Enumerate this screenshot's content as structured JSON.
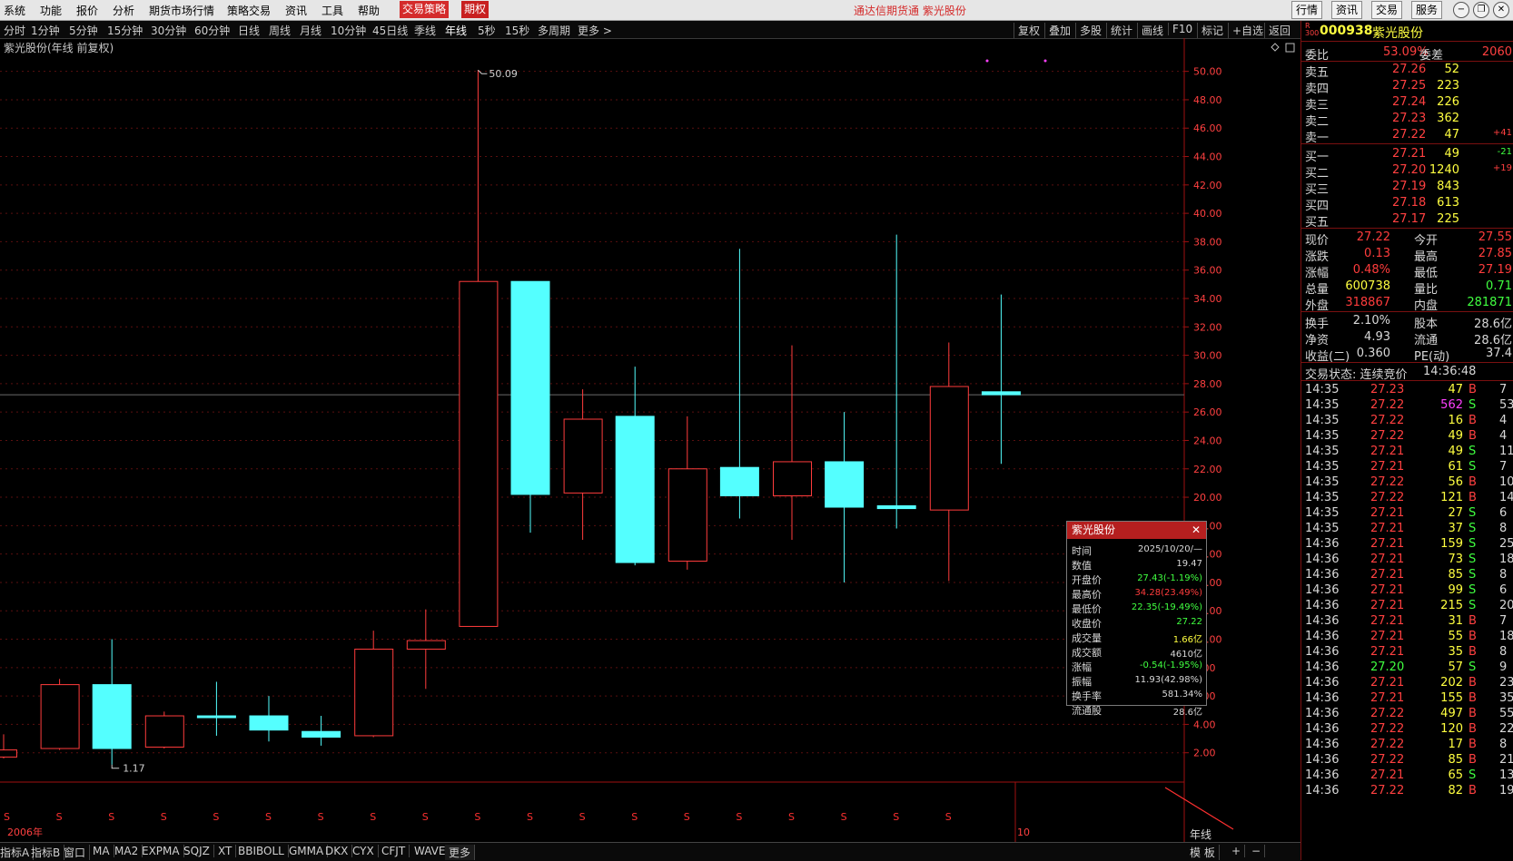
{
  "menu": {
    "items": [
      "系统",
      "功能",
      "报价",
      "分析",
      "期货市场行情",
      "策略交易",
      "资讯",
      "工具",
      "帮助",
      "交易策略",
      "期权"
    ],
    "title": "通达信期货通  紫光股份",
    "buttons": [
      "行情",
      "资讯",
      "交易",
      "服务"
    ]
  },
  "periods": {
    "items": [
      "分时",
      "1分钟",
      "5分钟",
      "15分钟",
      "30分钟",
      "60分钟",
      "日线",
      "周线",
      "月线",
      "10分钟",
      "45日线",
      "季线",
      "年线",
      "5秒",
      "15秒",
      "多周期",
      "更多 >"
    ],
    "active": "年线",
    "right_tools": [
      "复权",
      "叠加",
      "多股",
      "统计",
      "画线",
      "F10",
      "标记",
      "+自选",
      "返回"
    ]
  },
  "chart": {
    "label": "紫光股份(年线 前复权)",
    "max_label": "50.09",
    "min_label": "1.17",
    "start_year": "2006年",
    "end_marker": "10",
    "period_tag": "年线",
    "dividend_marker": "S",
    "colors": {
      "up": "#ff3c3c",
      "down": "#54ffff",
      "axis": "#a01010",
      "grid": "#5a0f0f"
    }
  },
  "chart_data": {
    "type": "candlestick",
    "title": "紫光股份(年线 前复权)",
    "ylim": [
      0,
      51
    ],
    "yticks": [
      2,
      4,
      6,
      8,
      10,
      12,
      14,
      16,
      18,
      20,
      22,
      24,
      26,
      28,
      30,
      32,
      34,
      36,
      38,
      40,
      42,
      44,
      46,
      48,
      50
    ],
    "candles": [
      {
        "open": 1.7,
        "close": 2.2,
        "high": 3.3,
        "low": 1.6,
        "dir": "up"
      },
      {
        "open": 2.3,
        "close": 6.8,
        "high": 7.2,
        "low": 2.2,
        "dir": "up"
      },
      {
        "open": 6.8,
        "close": 2.3,
        "high": 10.0,
        "low": 1.17,
        "dir": "down"
      },
      {
        "open": 2.4,
        "close": 4.6,
        "high": 4.9,
        "low": 2.3,
        "dir": "up"
      },
      {
        "open": 4.6,
        "close": 4.5,
        "high": 7.0,
        "low": 3.2,
        "dir": "down"
      },
      {
        "open": 4.6,
        "close": 3.6,
        "high": 6.0,
        "low": 2.8,
        "dir": "down"
      },
      {
        "open": 3.5,
        "close": 3.1,
        "high": 4.6,
        "low": 2.5,
        "dir": "down"
      },
      {
        "open": 3.2,
        "close": 9.3,
        "high": 10.6,
        "low": 3.1,
        "dir": "up"
      },
      {
        "open": 9.3,
        "close": 9.9,
        "high": 12.1,
        "low": 6.5,
        "dir": "up"
      },
      {
        "open": 10.9,
        "close": 35.2,
        "high": 50.09,
        "low": 10.9,
        "dir": "up"
      },
      {
        "open": 35.2,
        "close": 20.2,
        "high": 35.2,
        "low": 17.5,
        "dir": "down"
      },
      {
        "open": 20.3,
        "close": 25.5,
        "high": 27.6,
        "low": 17.0,
        "dir": "up"
      },
      {
        "open": 25.7,
        "close": 15.4,
        "high": 29.2,
        "low": 15.2,
        "dir": "down"
      },
      {
        "open": 15.5,
        "close": 22.0,
        "high": 25.7,
        "low": 14.9,
        "dir": "up"
      },
      {
        "open": 22.1,
        "close": 20.1,
        "high": 37.5,
        "low": 18.5,
        "dir": "down"
      },
      {
        "open": 20.1,
        "close": 22.5,
        "high": 30.7,
        "low": 17.0,
        "dir": "up"
      },
      {
        "open": 22.5,
        "close": 19.3,
        "high": 26.0,
        "low": 14.0,
        "dir": "down"
      },
      {
        "open": 19.4,
        "close": 19.2,
        "high": 38.5,
        "low": 17.8,
        "dir": "down"
      },
      {
        "open": 19.1,
        "close": 27.8,
        "high": 30.9,
        "low": 14.1,
        "dir": "up"
      },
      {
        "open": 27.43,
        "close": 27.22,
        "high": 34.28,
        "low": 22.35,
        "dir": "down"
      }
    ]
  },
  "quote": {
    "code": "000938",
    "name": "紫光股份",
    "badge": "R\n300",
    "weibi_label": "委比",
    "weibi": "53.09%",
    "weicha_label": "委差",
    "weicha": "2060",
    "asks": [
      {
        "label": "卖五",
        "price": "27.26",
        "vol": "52",
        "chg": ""
      },
      {
        "label": "卖四",
        "price": "27.25",
        "vol": "223",
        "chg": ""
      },
      {
        "label": "卖三",
        "price": "27.24",
        "vol": "226",
        "chg": ""
      },
      {
        "label": "卖二",
        "price": "27.23",
        "vol": "362",
        "chg": ""
      },
      {
        "label": "卖一",
        "price": "27.22",
        "vol": "47",
        "chg": "+41"
      }
    ],
    "bids": [
      {
        "label": "买一",
        "price": "27.21",
        "vol": "49",
        "chg": "-21"
      },
      {
        "label": "买二",
        "price": "27.20",
        "vol": "1240",
        "chg": "+19"
      },
      {
        "label": "买三",
        "price": "27.19",
        "vol": "843",
        "chg": ""
      },
      {
        "label": "买四",
        "price": "27.18",
        "vol": "613",
        "chg": ""
      },
      {
        "label": "买五",
        "price": "27.17",
        "vol": "225",
        "chg": ""
      }
    ],
    "stats": [
      {
        "l1": "现价",
        "v1": "27.22",
        "c1": "#ff3c3c",
        "l2": "今开",
        "v2": "27.55",
        "c2": "#ff3c3c"
      },
      {
        "l1": "涨跌",
        "v1": "0.13",
        "c1": "#ff3c3c",
        "l2": "最高",
        "v2": "27.85",
        "c2": "#ff3c3c"
      },
      {
        "l1": "涨幅",
        "v1": "0.48%",
        "c1": "#ff3c3c",
        "l2": "最低",
        "v2": "27.19",
        "c2": "#ff3c3c"
      },
      {
        "l1": "总量",
        "v1": "600738",
        "c1": "#ffff40",
        "l2": "量比",
        "v2": "0.71",
        "c2": "#40ff40"
      },
      {
        "l1": "外盘",
        "v1": "318867",
        "c1": "#ff3c3c",
        "l2": "内盘",
        "v2": "281871",
        "c2": "#40ff40"
      }
    ],
    "stats2": [
      {
        "l1": "换手",
        "v1": "2.10%",
        "l2": "股本",
        "v2": "28.6亿"
      },
      {
        "l1": "净资",
        "v1": "4.93",
        "l2": "流通",
        "v2": "28.6亿"
      },
      {
        "l1": "收益(二)",
        "v1": "0.360",
        "l2": "PE(动)",
        "v2": "37.4"
      }
    ],
    "status_label": "交易状态: 连续竞价",
    "status_time": "14:36:48"
  },
  "ticks": [
    {
      "t": "14:35",
      "p": "27.23",
      "v": "47",
      "s": "B",
      "n": "7"
    },
    {
      "t": "14:35",
      "p": "27.22",
      "v": "562",
      "s": "S",
      "n": "53"
    },
    {
      "t": "14:35",
      "p": "27.22",
      "v": "16",
      "s": "B",
      "n": "4"
    },
    {
      "t": "14:35",
      "p": "27.22",
      "v": "49",
      "s": "B",
      "n": "4"
    },
    {
      "t": "14:35",
      "p": "27.21",
      "v": "49",
      "s": "S",
      "n": "11"
    },
    {
      "t": "14:35",
      "p": "27.21",
      "v": "61",
      "s": "S",
      "n": "7"
    },
    {
      "t": "14:35",
      "p": "27.22",
      "v": "56",
      "s": "B",
      "n": "10"
    },
    {
      "t": "14:35",
      "p": "27.22",
      "v": "121",
      "s": "B",
      "n": "14"
    },
    {
      "t": "14:35",
      "p": "27.21",
      "v": "27",
      "s": "S",
      "n": "6"
    },
    {
      "t": "14:35",
      "p": "27.21",
      "v": "37",
      "s": "S",
      "n": "8"
    },
    {
      "t": "14:36",
      "p": "27.21",
      "v": "159",
      "s": "S",
      "n": "25"
    },
    {
      "t": "14:36",
      "p": "27.21",
      "v": "73",
      "s": "S",
      "n": "18"
    },
    {
      "t": "14:36",
      "p": "27.21",
      "v": "85",
      "s": "S",
      "n": "8"
    },
    {
      "t": "14:36",
      "p": "27.21",
      "v": "99",
      "s": "S",
      "n": "6"
    },
    {
      "t": "14:36",
      "p": "27.21",
      "v": "215",
      "s": "S",
      "n": "20"
    },
    {
      "t": "14:36",
      "p": "27.21",
      "v": "31",
      "s": "B",
      "n": "7"
    },
    {
      "t": "14:36",
      "p": "27.21",
      "v": "55",
      "s": "B",
      "n": "18"
    },
    {
      "t": "14:36",
      "p": "27.21",
      "v": "35",
      "s": "B",
      "n": "8"
    },
    {
      "t": "14:36",
      "p": "27.20",
      "v": "57",
      "s": "S",
      "n": "9"
    },
    {
      "t": "14:36",
      "p": "27.21",
      "v": "202",
      "s": "B",
      "n": "23"
    },
    {
      "t": "14:36",
      "p": "27.21",
      "v": "155",
      "s": "B",
      "n": "35"
    },
    {
      "t": "14:36",
      "p": "27.22",
      "v": "497",
      "s": "B",
      "n": "55"
    },
    {
      "t": "14:36",
      "p": "27.22",
      "v": "120",
      "s": "B",
      "n": "22"
    },
    {
      "t": "14:36",
      "p": "27.22",
      "v": "17",
      "s": "B",
      "n": "8"
    },
    {
      "t": "14:36",
      "p": "27.22",
      "v": "85",
      "s": "B",
      "n": "21"
    },
    {
      "t": "14:36",
      "p": "27.21",
      "v": "65",
      "s": "S",
      "n": "13"
    },
    {
      "t": "14:36",
      "p": "27.22",
      "v": "82",
      "s": "B",
      "n": "19"
    }
  ],
  "tooltip": {
    "title": "紫光股份",
    "rows": [
      {
        "label": "时间",
        "value": "2025/10/20/—",
        "color": "#d8d8d8"
      },
      {
        "label": "数值",
        "value": "19.47",
        "color": "#d8d8d8"
      },
      {
        "label": "开盘价",
        "value": "27.43(-1.19%)",
        "color": "#40ff40"
      },
      {
        "label": "最高价",
        "value": "34.28(23.49%)",
        "color": "#ff3c3c"
      },
      {
        "label": "最低价",
        "value": "22.35(-19.49%)",
        "color": "#40ff40"
      },
      {
        "label": "收盘价",
        "value": "27.22",
        "color": "#40ff40"
      },
      {
        "label": "成交量",
        "value": "1.66亿",
        "color": "#ffff40"
      },
      {
        "label": "成交额",
        "value": "4610亿",
        "color": "#d8d8d8"
      },
      {
        "label": "涨幅",
        "value": "-0.54(-1.95%)",
        "color": "#40ff40"
      },
      {
        "label": "振幅",
        "value": "11.93(42.98%)",
        "color": "#d8d8d8"
      },
      {
        "label": "换手率",
        "value": "581.34%",
        "color": "#d8d8d8"
      },
      {
        "label": "流通股",
        "value": "28.6亿",
        "color": "#d8d8d8"
      }
    ]
  },
  "bottom": {
    "items": [
      "指标A",
      "指标B",
      "窗口",
      "MA",
      "MA2",
      "EXPMA",
      "SQJZ",
      "XT",
      "BBIBOLL",
      "GMMA",
      "DKX",
      "CYX",
      "CFJT",
      "WAVE",
      "更多"
    ],
    "right": [
      "模 板",
      "+",
      "−"
    ]
  }
}
